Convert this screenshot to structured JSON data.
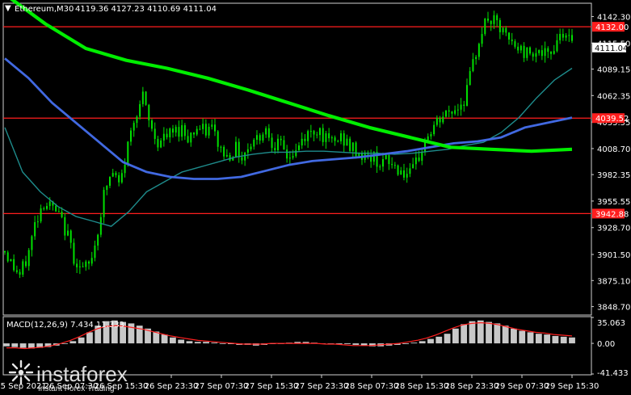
{
  "header": {
    "symbol": "Ethereum,M30",
    "ohlc": "4119.36 4127.23 4110.69 4111.04"
  },
  "macd_header": "MACD(12,26,9) 7.434 11.333",
  "watermark": {
    "brand": "instaforex",
    "tagline": "Instant Forex Trading"
  },
  "colors": {
    "background": "#000000",
    "candle": "#00e000",
    "ma_fast": "#1e8c8c",
    "ma_mid": "#4169e1",
    "ma_slow": "#00ee00",
    "level": "#ff1e1e",
    "macd_hist": "#c8c8c8",
    "macd_signal": "#ff2020"
  },
  "chart_data": [
    {
      "type": "candlestick",
      "title": "",
      "ylim": [
        3841,
        4155
      ],
      "y_ticks": [
        "4142.30",
        "4115.50",
        "4089.15",
        "4062.35",
        "4035.55",
        "4008.70",
        "3982.35",
        "3955.55",
        "3928.70",
        "3901.50",
        "3875.10",
        "3848.70"
      ],
      "x_ticks": [
        "25 Sep 2021",
        "26 Sep 07:30",
        "26 Sep 15:30",
        "26 Sep 23:30",
        "27 Sep 07:30",
        "27 Sep 15:30",
        "27 Sep 23:30",
        "28 Sep 07:30",
        "28 Sep 15:30",
        "28 Sep 23:30",
        "29 Sep 07:30",
        "29 Sep 15:30"
      ],
      "horizontal_levels": [
        "4132.00",
        "4039.52",
        "3942.88"
      ],
      "current_price": "4111.04",
      "price_path": [
        3905,
        3890,
        3880,
        3900,
        3935,
        3955,
        3950,
        3940,
        3925,
        3900,
        3885,
        3890,
        3920,
        3965,
        3985,
        3970,
        4010,
        4045,
        4060,
        4030,
        4015,
        4020,
        4025,
        4030,
        4020,
        4030,
        4025,
        4030,
        4010,
        4000,
        4010,
        4000,
        4015,
        4020,
        4030,
        4015,
        4010,
        4000,
        4005,
        4020,
        4025,
        4030,
        4015,
        4015,
        4020,
        4010,
        4005,
        4000,
        4000,
        3995,
        3995,
        3990,
        3985,
        3980,
        4000,
        4020,
        4030,
        4040,
        4045,
        4050,
        4060,
        4090,
        4125,
        4140,
        4135,
        4125,
        4115,
        4110,
        4105,
        4110,
        4105,
        4100,
        4120,
        4130,
        4111
      ],
      "series": [
        {
          "name": "",
          "values": [
            4030,
            3985,
            3965,
            3950,
            3940,
            3935,
            3930,
            3945,
            3965,
            3975,
            3985,
            3990,
            3995,
            4000,
            4003,
            4005,
            4005,
            4006,
            4006,
            4005,
            4004,
            4004,
            4003,
            4004,
            4006,
            4008,
            4012,
            4015,
            4025,
            4040,
            4060,
            4078,
            4090
          ]
        },
        {
          "name": "",
          "values": [
            4100,
            4080,
            4055,
            4035,
            4015,
            3995,
            3985,
            3980,
            3978,
            3978,
            3980,
            3986,
            3992,
            3996,
            3998,
            4000,
            4003,
            4006,
            4010,
            4014,
            4016,
            4020,
            4030,
            4035,
            4040
          ]
        },
        {
          "name": "",
          "values": [
            4165,
            4135,
            4110,
            4098,
            4090,
            4080,
            4068,
            4055,
            4042,
            4030,
            4020,
            4010,
            4008,
            4006,
            4008
          ]
        }
      ]
    },
    {
      "type": "bar",
      "title": "",
      "ylim": [
        -41.433,
        35.063
      ],
      "y_ticks": [
        "35.063",
        "0.00",
        "-41.433"
      ],
      "histogram": [
        -4,
        -5,
        -6,
        -7,
        -6,
        -5,
        -3,
        0,
        3,
        8,
        15,
        24,
        30,
        31,
        29,
        27,
        24,
        20,
        16,
        12,
        8,
        5,
        3,
        2,
        2,
        1,
        0,
        -1,
        -2,
        -2,
        -3,
        -2,
        -1,
        0,
        1,
        2,
        2,
        1,
        0,
        0,
        -1,
        -1,
        -2,
        -3,
        -4,
        -4,
        -3,
        -2,
        -1,
        1,
        3,
        6,
        9,
        13,
        20,
        26,
        30,
        31,
        29,
        27,
        24,
        20,
        17,
        15,
        13,
        12,
        10,
        9,
        8
      ],
      "signal": [
        -6,
        -6,
        -7,
        -6,
        -5,
        -3,
        0,
        4,
        9,
        15,
        20,
        23,
        24,
        23,
        21,
        19,
        16,
        13,
        10,
        8,
        6,
        4,
        3,
        2,
        1,
        0,
        -1,
        -1,
        -1,
        0,
        0,
        0,
        0,
        0,
        0,
        -1,
        -1,
        -2,
        -3,
        -3,
        -3,
        -2,
        -1,
        0,
        2,
        4,
        7,
        11,
        16,
        21,
        25,
        27,
        28,
        27,
        25,
        22,
        19,
        17,
        15,
        14,
        12,
        11,
        10
      ]
    }
  ]
}
